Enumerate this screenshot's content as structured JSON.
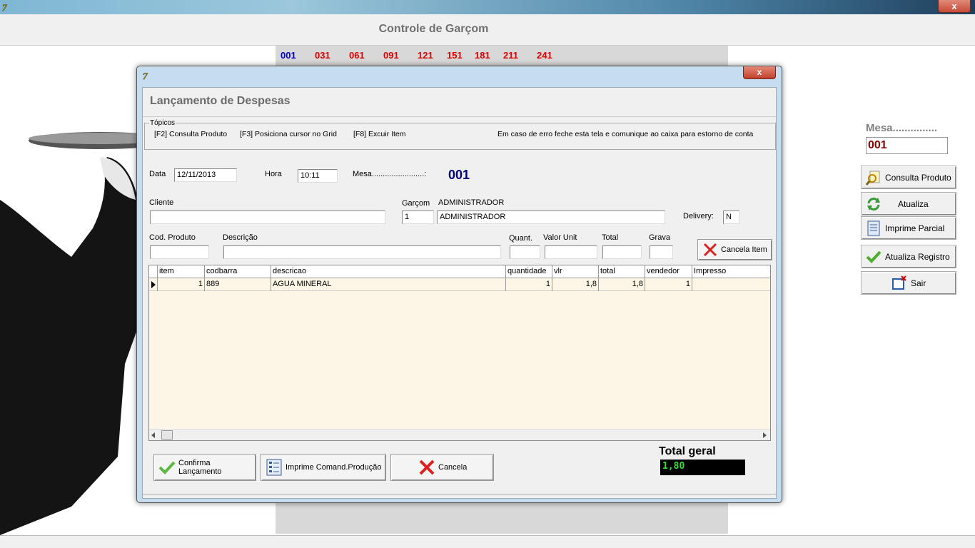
{
  "window": {
    "title": "Controle de Garçom",
    "close_label": "x"
  },
  "tables": {
    "row1": [
      {
        "label": "001",
        "color": "#0000cc"
      },
      {
        "label": "031",
        "color": "#dd0000"
      },
      {
        "label": "061",
        "color": "#dd0000"
      },
      {
        "label": "091",
        "color": "#dd0000"
      },
      {
        "label": "121",
        "color": "#dd0000"
      },
      {
        "label": "151",
        "color": "#dd0000"
      },
      {
        "label": "181",
        "color": "#dd0000"
      },
      {
        "label": "211",
        "color": "#dd0000"
      },
      {
        "label": "241",
        "color": "#dd0000"
      }
    ]
  },
  "side": {
    "mesa_label": "Mesa...............",
    "mesa_value": "001",
    "buttons": [
      {
        "label": "Consulta Produto",
        "icon": "search-icon"
      },
      {
        "label": "Atualiza",
        "icon": "refresh-icon"
      },
      {
        "label": "Imprime Parcial",
        "icon": "print-icon"
      },
      {
        "label": "Atualiza Registro",
        "icon": "check-icon"
      },
      {
        "label": "Sair",
        "icon": "exit-icon"
      }
    ]
  },
  "dialog": {
    "title": "Lançamento de Despesas",
    "close_label": "x",
    "topics": {
      "legend": "Tópicos",
      "items": [
        "[F2] Consulta Produto",
        "[F3] Posiciona cursor no Grid",
        "[F8] Excuir Item",
        "Em caso de erro feche esta tela e comunique ao caixa para estorno de conta"
      ]
    },
    "form": {
      "data_label": "Data",
      "data_value": "12/11/2013",
      "hora_label": "Hora",
      "hora_value": "10:11",
      "mesa_label": "Mesa........................:",
      "mesa_value": "001",
      "cliente_label": "Cliente",
      "cliente_value": "",
      "garcom_label": "Garçom",
      "garcom_name_label": "ADMINISTRADOR",
      "garcom_code": "1",
      "garcom_name": "ADMINISTRADOR",
      "delivery_label": "Delivery:",
      "delivery_value": "N",
      "cod_produto_label": "Cod. Produto",
      "descricao_label": "Descrição",
      "quant_label": "Quant.",
      "valor_unit_label": "Valor Unit",
      "total_label": "Total",
      "grava_label": "Grava",
      "cancela_item_label": "Cancela Item"
    },
    "grid": {
      "columns": [
        "item",
        "codbarra",
        "descricao",
        "quantidade",
        "vlr",
        "total",
        "vendedor",
        "Impresso"
      ],
      "rows": [
        {
          "item": "1",
          "codbarra": "889",
          "descricao": "AGUA MINERAL",
          "quantidade": "1",
          "vlr": "1,8",
          "total": "1,8",
          "vendedor": "1",
          "impresso": ""
        }
      ]
    },
    "buttons": {
      "confirma": "Confirma Lançamento",
      "imprime": "Imprime Comand.Produção",
      "cancela": "Cancela"
    },
    "total_geral_label": "Total geral",
    "total_geral_value": "1,80"
  }
}
